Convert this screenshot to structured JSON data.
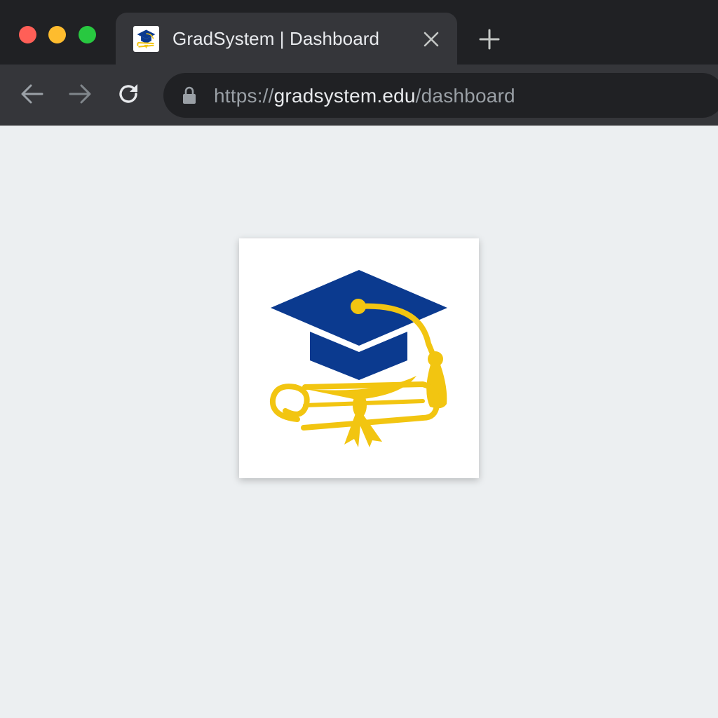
{
  "window": {
    "controls": {
      "close_color": "#ff5f57",
      "minimize_color": "#febc2e",
      "zoom_color": "#28c840"
    }
  },
  "tab": {
    "title": "GradSystem | Dashboard",
    "favicon": "graduation-cap-diploma-icon",
    "close_icon": "close-icon"
  },
  "toolbar": {
    "new_tab_icon": "plus-icon",
    "back_icon": "arrow-left-icon",
    "forward_icon": "arrow-right-icon",
    "reload_icon": "reload-icon",
    "lock_icon": "lock-icon",
    "url": {
      "scheme": "https://",
      "host": "gradsystem.edu",
      "path": "/dashboard"
    }
  },
  "content": {
    "logo": {
      "icon": "graduation-cap-diploma-logo",
      "cap_color": "#0b3a8f",
      "gold_color": "#f2c511",
      "background": "#ffffff"
    },
    "background": "#eceff1"
  }
}
